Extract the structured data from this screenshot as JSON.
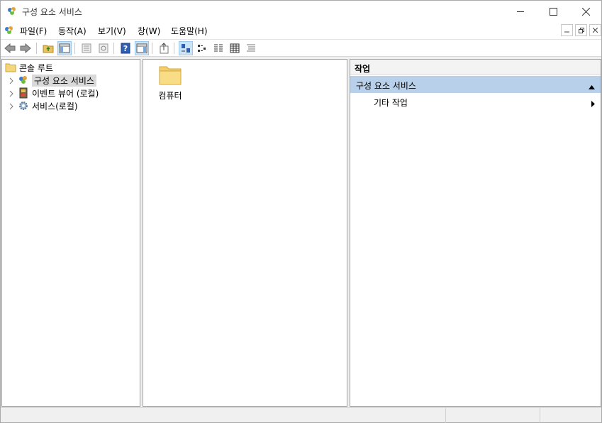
{
  "window": {
    "title": "구성 요소 서비스",
    "app_icon": "component-services-icon"
  },
  "menu": {
    "items": [
      "파일(F)",
      "동작(A)",
      "보기(V)",
      "창(W)",
      "도움말(H)"
    ]
  },
  "tree": {
    "root": "콘솔 루트",
    "nodes": [
      {
        "label": "구성 요소 서비스",
        "icon": "component-services-icon",
        "selected": true
      },
      {
        "label": "이벤트 뷰어 (로컬)",
        "icon": "event-viewer-icon",
        "selected": false
      },
      {
        "label": "서비스(로컬)",
        "icon": "services-gear-icon",
        "selected": false
      }
    ]
  },
  "content": {
    "items": [
      {
        "label": "컴퓨터",
        "icon": "folder-icon"
      }
    ]
  },
  "actions": {
    "header": "작업",
    "section_title": "구성 요소 서비스",
    "items": [
      "기타 작업"
    ]
  },
  "colors": {
    "section_bg": "#b8d0ea",
    "selected_bg": "#d9d9d9",
    "toolbar_active_bg": "#cce4f7"
  }
}
